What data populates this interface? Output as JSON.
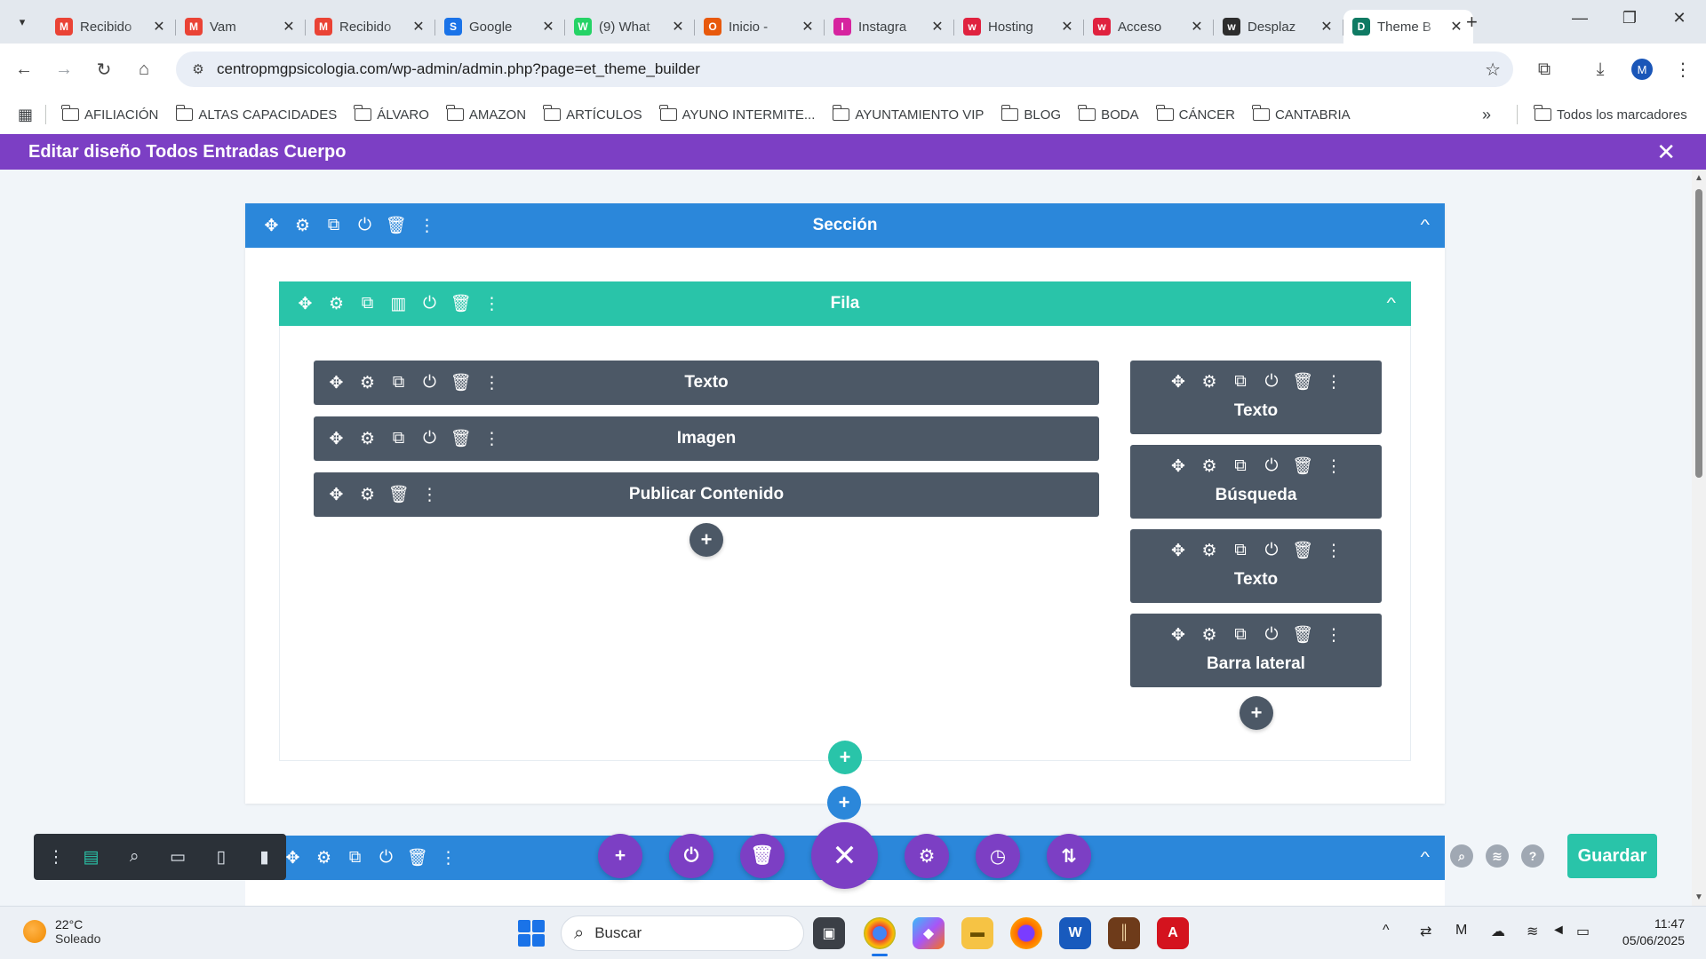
{
  "browser": {
    "tabs": [
      {
        "label": "Recibido",
        "favicon": "gmail-icon",
        "color": "#ea4335",
        "glyph": "M"
      },
      {
        "label": "Vam",
        "favicon": "gmail-icon",
        "color": "#ea4335",
        "glyph": "M"
      },
      {
        "label": "Recibido",
        "favicon": "gmail-icon",
        "color": "#ea4335",
        "glyph": "M"
      },
      {
        "label": "Google",
        "favicon": "google-sites-icon",
        "color": "#1a73e8",
        "glyph": "S"
      },
      {
        "label": "(9) What",
        "favicon": "whatsapp-icon",
        "color": "#25d366",
        "glyph": "W"
      },
      {
        "label": "Inicio -",
        "favicon": "office-icon",
        "color": "#e8590c",
        "glyph": "O"
      },
      {
        "label": "Instagra",
        "favicon": "instagram-icon",
        "color": "#d6249f",
        "glyph": "I"
      },
      {
        "label": "Hosting",
        "favicon": "webempresa-icon",
        "color": "#e0223f",
        "glyph": "w"
      },
      {
        "label": "Acceso",
        "favicon": "webempresa-icon",
        "color": "#e0223f",
        "glyph": "w"
      },
      {
        "label": "Desplaz",
        "favicon": "webempresa-icon",
        "color": "#2d2d2d",
        "glyph": "w"
      },
      {
        "label": "Theme B",
        "favicon": "divi-icon",
        "color": "#0f7a63",
        "glyph": "D",
        "active": true
      }
    ],
    "url": "centropmgpsicologia.com/wp-admin/admin.php?page=et_theme_builder",
    "profile_initial": "M",
    "bookmarks": [
      "AFILIACIÓN",
      "ALTAS CAPACIDADES",
      "ÁLVARO",
      "AMAZON",
      "ARTÍCULOS",
      "AYUNO INTERMITE...",
      "AYUNTAMIENTO VIP",
      "BLOG",
      "BODA",
      "CÁNCER",
      "CANTABRIA"
    ],
    "all_bookmarks": "Todos los marcadores"
  },
  "builder": {
    "header_title": "Editar diseño Todos Entradas Cuerpo",
    "section_label": "Sección",
    "row_label": "Fila",
    "left_column_modules": [
      "Texto",
      "Imagen",
      "Publicar Contenido"
    ],
    "right_column_modules": [
      "Texto",
      "Búsqueda",
      "Texto",
      "Barra lateral"
    ],
    "save_label": "Guardar",
    "colors": {
      "purple": "#7c3fc4",
      "section_blue": "#2b87da",
      "row_teal": "#29c4a9",
      "module_gray": "#4c5866"
    }
  },
  "taskbar": {
    "temperature": "22°C",
    "weather": "Soleado",
    "search_placeholder": "Buscar",
    "time": "11:47",
    "date": "05/06/2025"
  }
}
